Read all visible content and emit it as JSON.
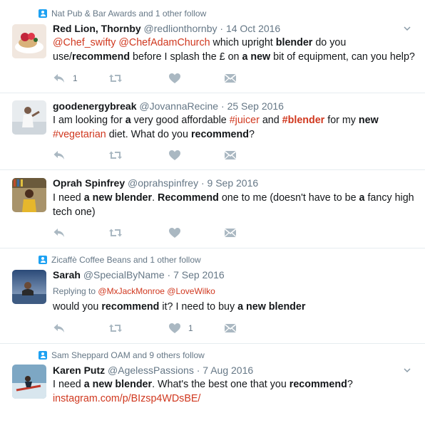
{
  "tweets": [
    {
      "context": "Nat Pub & Bar Awards and 1 other follow",
      "name": "Red Lion, Thornby",
      "handle": "@redlionthornby",
      "sep": "·",
      "date": "14 Oct 2016",
      "reply_count": "1",
      "like_count": ""
    },
    {
      "context": "",
      "name": "goodenergybreak",
      "handle": "@JovannaRecine",
      "sep": "·",
      "date": "25 Sep 2016",
      "reply_count": "",
      "like_count": ""
    },
    {
      "context": "",
      "name": "Oprah Spinfrey",
      "handle": "@oprahspinfrey",
      "sep": "·",
      "date": "9 Sep 2016",
      "reply_count": "",
      "like_count": ""
    },
    {
      "context": "Zicaffè Coffee Beans and 1 other follow",
      "name": "Sarah",
      "handle": "@SpecialByName",
      "sep": "·",
      "date": "7 Sep 2016",
      "replying_prefix": "Replying to",
      "replying_1": "@MxJackMonroe",
      "replying_2": "@LoveWilko",
      "reply_count": "",
      "like_count": "1"
    },
    {
      "context": "Sam Sheppard OAM and 9 others follow",
      "name": "Karen Putz",
      "handle": "@AgelessPassions",
      "sep": "·",
      "date": "7 Aug 2016",
      "reply_count": "",
      "like_count": ""
    }
  ],
  "t1_text": {
    "m1": "@Chef_swifty",
    "m2": "@ChefAdamChurch",
    "p1": " which upright ",
    "b1": "blender",
    "p2": " do you use/",
    "b2": "recommend",
    "p3": " before I splash the £ on ",
    "b3": "a new",
    "p4": " bit of equipment, can you help?"
  },
  "t2_text": {
    "p1": "I am looking for ",
    "b1": "a",
    "p2": " very good affordable ",
    "h1": "#juicer",
    "p3": " and ",
    "h2": "#blender",
    "p4": " for my ",
    "b2": "new",
    "h3": "#vegetarian",
    "p5": " diet. What do you ",
    "b3": "recommend",
    "p6": "?"
  },
  "t3_text": {
    "p1": "I need ",
    "b1": "a new blender",
    "p2": ". ",
    "b2": "Recommend",
    "p3": " one to me (doesn't have to be ",
    "b3": "a",
    "p4": " fancy high tech one)"
  },
  "t4_text": {
    "p1": "would you ",
    "b1": "recommend",
    "p2": " it? I need to buy ",
    "b2": "a new blender"
  },
  "t5_text": {
    "p1": "I need ",
    "b1": "a new blender",
    "p2": ". What's the best one that you ",
    "b2": "recommend",
    "p3": "?",
    "link": "instagram.com/p/BIzsp4WDsBE/"
  },
  "colors": {
    "mention": "#d0381f",
    "context_icon": "#1da1f2",
    "action_icon": "#8899a6"
  },
  "icons": [
    "person-icon",
    "chevron-down-icon",
    "reply-icon",
    "retweet-icon",
    "like-icon",
    "message-icon"
  ]
}
